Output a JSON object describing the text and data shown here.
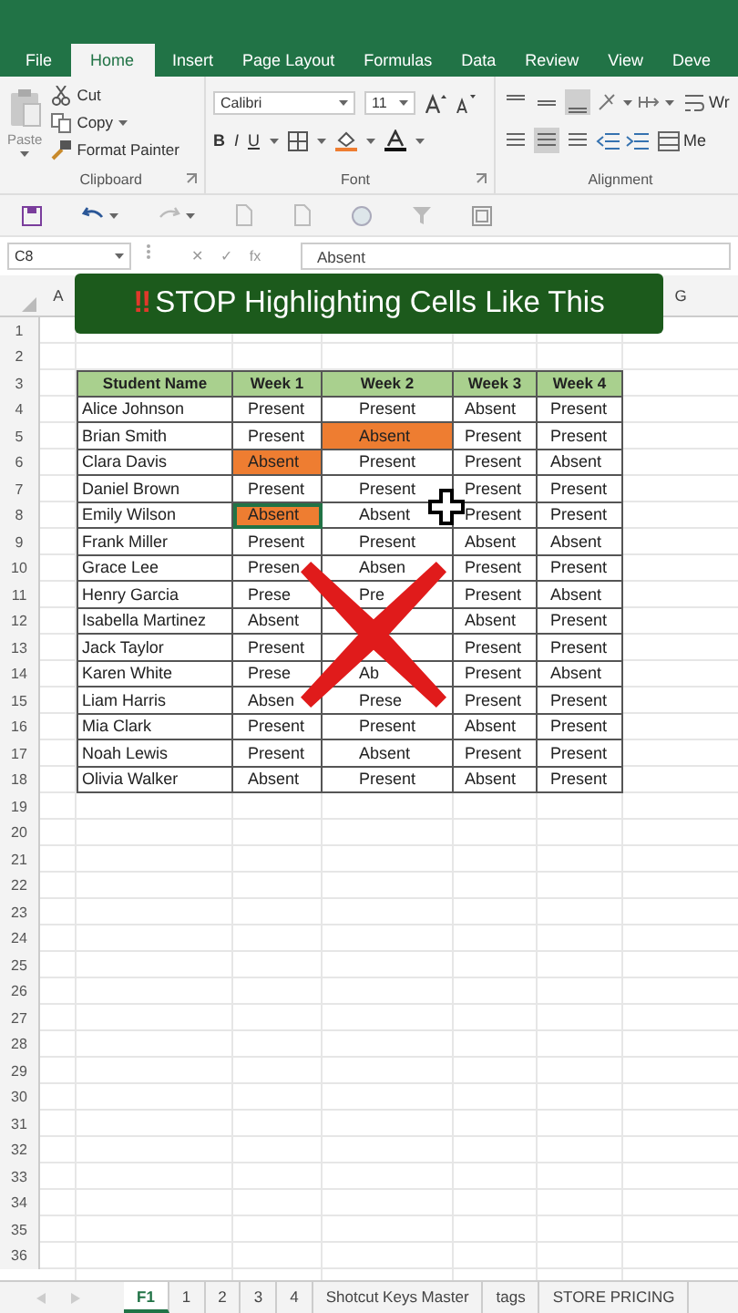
{
  "ribbon": {
    "tabs": [
      {
        "label": "File",
        "selected": false
      },
      {
        "label": "Home",
        "selected": true
      },
      {
        "label": "Insert",
        "selected": false
      },
      {
        "label": "Page Layout",
        "selected": false
      },
      {
        "label": "Formulas",
        "selected": false
      },
      {
        "label": "Data",
        "selected": false
      },
      {
        "label": "Review",
        "selected": false
      },
      {
        "label": "View",
        "selected": false
      },
      {
        "label": "Deve",
        "selected": false
      }
    ],
    "clipboard": {
      "paste": "Paste",
      "cut": "Cut",
      "copy": "Copy",
      "format_painter": "Format Painter",
      "label": "Clipboard"
    },
    "font": {
      "name": "Calibri",
      "size": "11",
      "bold": "B",
      "italic": "I",
      "underline": "U",
      "label": "Font"
    },
    "alignment": {
      "wrap": "Wr",
      "merge": "Me",
      "label": "Alignment"
    }
  },
  "formula_bar": {
    "name_box": "C8",
    "buttons": [
      "✕",
      "✓",
      "fx"
    ],
    "value": "Absent"
  },
  "banner": {
    "mark": "‼",
    "text": "STOP Highlighting Cells Like This"
  },
  "sheet": {
    "column_headers": [
      "A",
      "G"
    ],
    "row_numbers": [
      "1",
      "2",
      "3",
      "4",
      "5",
      "6",
      "7",
      "8",
      "9",
      "10",
      "11",
      "12",
      "13",
      "14",
      "15",
      "16",
      "17",
      "18",
      "19",
      "20",
      "21",
      "22",
      "23",
      "24",
      "25",
      "26",
      "27",
      "28",
      "29",
      "30",
      "31",
      "32",
      "33",
      "34",
      "35",
      "36"
    ],
    "table": {
      "header": [
        "Student Name",
        "Week 1",
        "Week 2",
        "Week 3",
        "Week 4"
      ],
      "rows": [
        {
          "name": "Alice Johnson",
          "cells": [
            {
              "text": "Present",
              "highlighted": false,
              "selected": false
            },
            {
              "text": "Present",
              "highlighted": false,
              "selected": false
            },
            {
              "text": "Absent",
              "highlighted": false,
              "selected": false
            },
            {
              "text": "Present",
              "highlighted": false,
              "selected": false
            }
          ]
        },
        {
          "name": "Brian Smith",
          "cells": [
            {
              "text": "Present",
              "highlighted": false,
              "selected": false
            },
            {
              "text": "Absent",
              "highlighted": true,
              "selected": false
            },
            {
              "text": "Present",
              "highlighted": false,
              "selected": false
            },
            {
              "text": "Present",
              "highlighted": false,
              "selected": false
            }
          ]
        },
        {
          "name": "Clara Davis",
          "cells": [
            {
              "text": "Absent",
              "highlighted": true,
              "selected": false
            },
            {
              "text": "Present",
              "highlighted": false,
              "selected": false
            },
            {
              "text": "Present",
              "highlighted": false,
              "selected": false
            },
            {
              "text": "Absent",
              "highlighted": false,
              "selected": false
            }
          ]
        },
        {
          "name": "Daniel Brown",
          "cells": [
            {
              "text": "Present",
              "highlighted": false,
              "selected": false
            },
            {
              "text": "Present",
              "highlighted": false,
              "selected": false
            },
            {
              "text": "Present",
              "highlighted": false,
              "selected": false
            },
            {
              "text": "Present",
              "highlighted": false,
              "selected": false
            }
          ]
        },
        {
          "name": "Emily Wilson",
          "cells": [
            {
              "text": "Absent",
              "highlighted": true,
              "selected": true
            },
            {
              "text": "Absent",
              "highlighted": false,
              "selected": false
            },
            {
              "text": "Present",
              "highlighted": false,
              "selected": false
            },
            {
              "text": "Present",
              "highlighted": false,
              "selected": false
            }
          ]
        },
        {
          "name": "Frank Miller",
          "cells": [
            {
              "text": "Present",
              "highlighted": false,
              "selected": false
            },
            {
              "text": "Present",
              "highlighted": false,
              "selected": false
            },
            {
              "text": "Absent",
              "highlighted": false,
              "selected": false
            },
            {
              "text": "Absent",
              "highlighted": false,
              "selected": false
            }
          ]
        },
        {
          "name": "Grace Lee",
          "cells": [
            {
              "text": "Presen",
              "highlighted": false,
              "selected": false
            },
            {
              "text": "Absen",
              "highlighted": false,
              "selected": false
            },
            {
              "text": "Present",
              "highlighted": false,
              "selected": false
            },
            {
              "text": "Present",
              "highlighted": false,
              "selected": false
            }
          ]
        },
        {
          "name": "Henry Garcia",
          "cells": [
            {
              "text": "Prese",
              "highlighted": false,
              "selected": false
            },
            {
              "text": "Pre",
              "highlighted": false,
              "selected": false
            },
            {
              "text": "Present",
              "highlighted": false,
              "selected": false
            },
            {
              "text": "Absent",
              "highlighted": false,
              "selected": false
            }
          ]
        },
        {
          "name": "Isabella Martinez",
          "cells": [
            {
              "text": "Absent",
              "highlighted": false,
              "selected": false
            },
            {
              "highlighted": false,
              "selected": false
            },
            {
              "text": "Absent",
              "highlighted": false,
              "selected": false
            },
            {
              "text": "Present",
              "highlighted": false,
              "selected": false
            }
          ]
        },
        {
          "name": "Jack Taylor",
          "cells": [
            {
              "text": "Present",
              "highlighted": false,
              "selected": false
            },
            {
              "highlighted": false,
              "selected": false
            },
            {
              "text": "Present",
              "highlighted": false,
              "selected": false
            },
            {
              "text": "Present",
              "highlighted": false,
              "selected": false
            }
          ]
        },
        {
          "name": "Karen White",
          "cells": [
            {
              "text": "Prese",
              "highlighted": false,
              "selected": false
            },
            {
              "text": "Ab",
              "highlighted": false,
              "selected": false
            },
            {
              "text": "Present",
              "highlighted": false,
              "selected": false
            },
            {
              "text": "Absent",
              "highlighted": false,
              "selected": false
            }
          ]
        },
        {
          "name": "Liam Harris",
          "cells": [
            {
              "text": "Absen",
              "highlighted": false,
              "selected": false
            },
            {
              "text": "Prese",
              "highlighted": false,
              "selected": false
            },
            {
              "text": "Present",
              "highlighted": false,
              "selected": false
            },
            {
              "text": "Present",
              "highlighted": false,
              "selected": false
            }
          ]
        },
        {
          "name": "Mia Clark",
          "cells": [
            {
              "text": "Present",
              "highlighted": false,
              "selected": false
            },
            {
              "text": "Present",
              "highlighted": false,
              "selected": false
            },
            {
              "text": "Absent",
              "highlighted": false,
              "selected": false
            },
            {
              "text": "Present",
              "highlighted": false,
              "selected": false
            }
          ]
        },
        {
          "name": "Noah Lewis",
          "cells": [
            {
              "text": "Present",
              "highlighted": false,
              "selected": false
            },
            {
              "text": "Absent",
              "highlighted": false,
              "selected": false
            },
            {
              "text": "Present",
              "highlighted": false,
              "selected": false
            },
            {
              "text": "Present",
              "highlighted": false,
              "selected": false
            }
          ]
        },
        {
          "name": "Olivia Walker",
          "cells": [
            {
              "text": "Absent",
              "highlighted": false,
              "selected": false
            },
            {
              "text": "Present",
              "highlighted": false,
              "selected": false
            },
            {
              "text": "Absent",
              "highlighted": false,
              "selected": false
            },
            {
              "text": "Present",
              "highlighted": false,
              "selected": false
            }
          ]
        }
      ]
    }
  },
  "sheet_tabs": [
    {
      "label": "F1",
      "selected": true
    },
    {
      "label": "1",
      "selected": false
    },
    {
      "label": "2",
      "selected": false
    },
    {
      "label": "3",
      "selected": false
    },
    {
      "label": "4",
      "selected": false
    },
    {
      "label": "Shotcut Keys Master",
      "selected": false
    },
    {
      "label": "tags",
      "selected": false
    },
    {
      "label": "STORE PRICING",
      "selected": false
    }
  ]
}
